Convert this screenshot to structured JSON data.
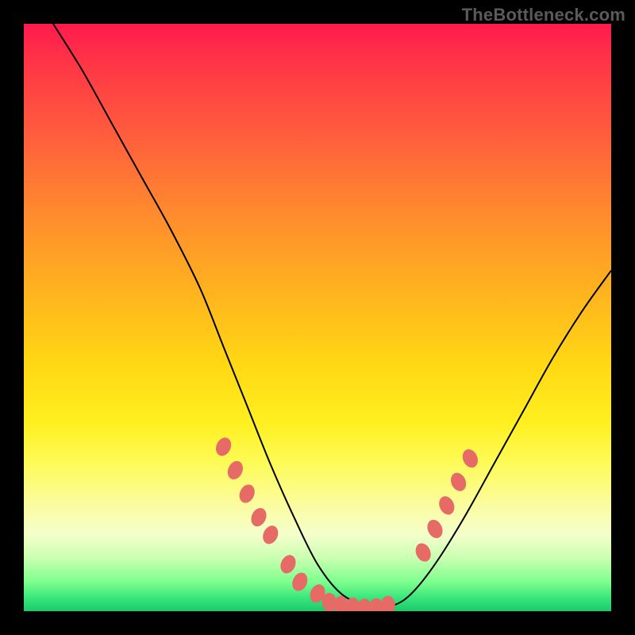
{
  "watermark": "TheBottleneck.com",
  "chart_data": {
    "type": "line",
    "title": "",
    "xlabel": "",
    "ylabel": "",
    "xlim": [
      0,
      100
    ],
    "ylim": [
      0,
      100
    ],
    "grid": false,
    "legend": false,
    "series": [
      {
        "name": "bottleneck-curve",
        "x": [
          5,
          10,
          15,
          20,
          25,
          30,
          34,
          38,
          42,
          46,
          50,
          54,
          58,
          60,
          63,
          66,
          70,
          75,
          80,
          85,
          90,
          95,
          100
        ],
        "y": [
          100,
          92,
          83,
          74,
          65,
          55,
          45,
          35,
          25,
          16,
          8,
          3,
          1,
          0.6,
          1,
          3,
          8,
          16,
          25,
          34,
          43,
          51,
          58
        ],
        "color": "#000000",
        "width": 2
      }
    ],
    "markers": [
      {
        "name": "highlight-dots-left",
        "x": [
          34,
          36,
          38,
          40,
          42,
          45,
          47,
          50
        ],
        "y": [
          28,
          24,
          20,
          16,
          13,
          8,
          5,
          3
        ],
        "color": "#e66a66",
        "size": 10
      },
      {
        "name": "highlight-dots-bottom",
        "x": [
          52,
          54,
          56,
          58,
          60,
          62
        ],
        "y": [
          1.5,
          1,
          0.7,
          0.5,
          0.6,
          1
        ],
        "color": "#e66a66",
        "size": 10
      },
      {
        "name": "highlight-dots-right",
        "x": [
          68,
          70,
          72,
          74,
          76
        ],
        "y": [
          10,
          14,
          18,
          22,
          26
        ],
        "color": "#e66a66",
        "size": 10
      }
    ],
    "gradient_stops": [
      {
        "pos": 0,
        "color": "#ff1a4d"
      },
      {
        "pos": 18,
        "color": "#ff5a3e"
      },
      {
        "pos": 46,
        "color": "#ffb41e"
      },
      {
        "pos": 68,
        "color": "#fff020"
      },
      {
        "pos": 87,
        "color": "#f4ffcc"
      },
      {
        "pos": 100,
        "color": "#1cc96a"
      }
    ]
  }
}
